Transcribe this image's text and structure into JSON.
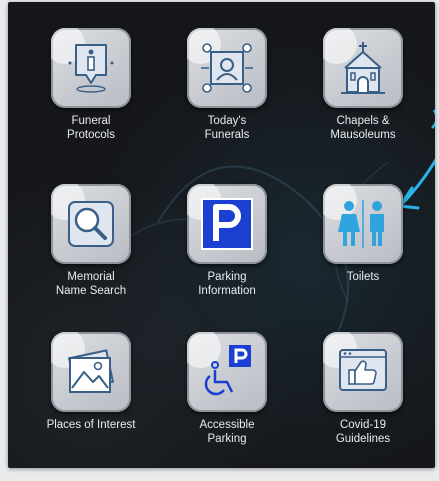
{
  "tiles": [
    {
      "label": "Funeral\nProtocols",
      "icon": "info-pin-icon"
    },
    {
      "label": "Today's\nFunerals",
      "icon": "person-frame-icon"
    },
    {
      "label": "Chapels &\nMausoleums",
      "icon": "chapel-icon"
    },
    {
      "label": "Memorial\nName Search",
      "icon": "magnifier-icon"
    },
    {
      "label": "Parking\nInformation",
      "icon": "parking-sign-icon"
    },
    {
      "label": "Toilets",
      "icon": "toilets-icon"
    },
    {
      "label": "Places of Interest",
      "icon": "photos-icon"
    },
    {
      "label": "Accessible\nParking",
      "icon": "accessible-parking-icon"
    },
    {
      "label": "Covid-19\nGuidelines",
      "icon": "thumbs-up-screen-icon"
    }
  ],
  "colors": {
    "background": "#15171b",
    "icon_stroke": "#3a5f86",
    "parking_blue": "#1a3fd1",
    "toilet_blue": "#2ea3dd",
    "annotation_arrow": "#2bb3e8",
    "label_text": "#e9ecef"
  }
}
